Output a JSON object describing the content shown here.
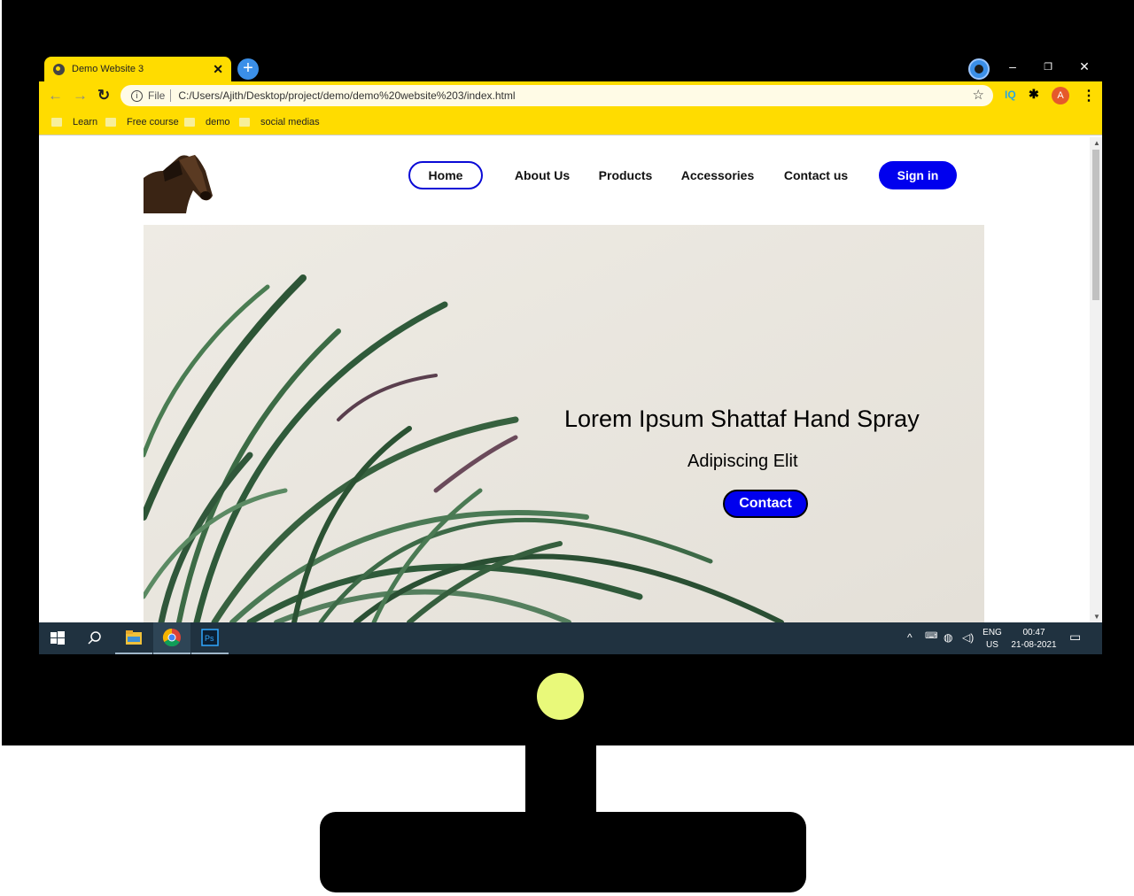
{
  "browser": {
    "tab_title": "Demo Website 3",
    "url_scheme_label": "File",
    "url": "C:/Users/Ajith/Desktop/project/demo/demo%20website%203/index.html",
    "extension_iq": "IQ",
    "profile_initial": "A",
    "bookmarks": [
      "Learn",
      "Free course",
      "demo",
      "social medias"
    ],
    "accent_color": "#ffdc00"
  },
  "site": {
    "nav": {
      "home": "Home",
      "about": "About Us",
      "products": "Products",
      "accessories": "Accessories",
      "contact": "Contact us",
      "signin": "Sign in"
    },
    "hero": {
      "title": "Lorem Ipsum Shattaf Hand Spray",
      "subtitle": "Adipiscing Elit",
      "button": "Contact"
    },
    "brand_blue": "#0000ee"
  },
  "taskbar": {
    "lang_top": "ENG",
    "lang_bottom": "US",
    "time": "00:47",
    "date": "21-08-2021"
  }
}
